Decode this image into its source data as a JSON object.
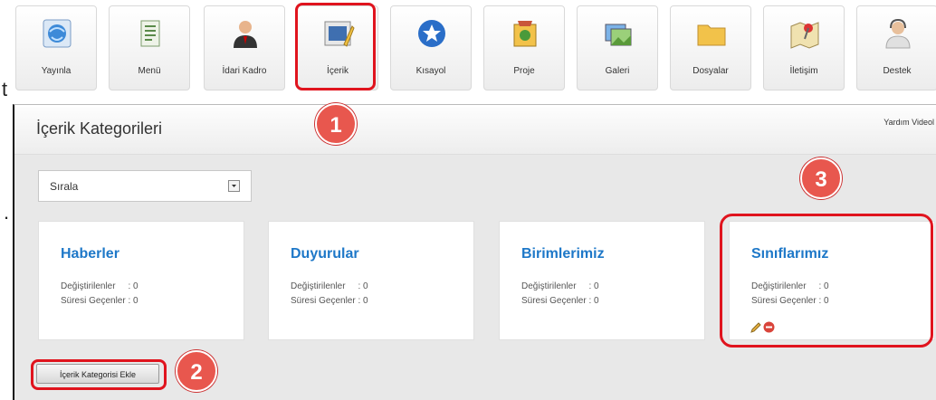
{
  "toolbar": {
    "items": [
      {
        "label": "Yayınla",
        "icon": "globe-icon"
      },
      {
        "label": "Menü",
        "icon": "menu-list-icon"
      },
      {
        "label": "İdari Kadro",
        "icon": "person-icon"
      },
      {
        "label": "İçerik",
        "icon": "content-icon"
      },
      {
        "label": "Kısayol",
        "icon": "star-icon"
      },
      {
        "label": "Proje",
        "icon": "project-icon"
      },
      {
        "label": "Galeri",
        "icon": "gallery-icon"
      },
      {
        "label": "Dosyalar",
        "icon": "folder-icon"
      },
      {
        "label": "İletişim",
        "icon": "map-pin-icon"
      },
      {
        "label": "Destek",
        "icon": "support-icon"
      }
    ]
  },
  "left_fragments": {
    "top": "t",
    "bottom": "."
  },
  "page": {
    "title": "İçerik Kategorileri",
    "help": "Yardım Videol"
  },
  "sort": {
    "value": "Sırala"
  },
  "cards": [
    {
      "title": "Haberler",
      "changed": "Değiştirilenler     : 0",
      "expired": "Süresi Geçenler : 0"
    },
    {
      "title": "Duyurular",
      "changed": "Değiştirilenler     : 0",
      "expired": "Süresi Geçenler : 0"
    },
    {
      "title": "Birimlerimiz",
      "changed": "Değiştirilenler     : 0",
      "expired": "Süresi Geçenler : 0"
    },
    {
      "title": "Sınıflarımız",
      "changed": "Değiştirilenler     : 0",
      "expired": "Süresi Geçenler : 0"
    }
  ],
  "add_button": "İçerik Kategorisi Ekle",
  "callouts": [
    "1",
    "2",
    "3"
  ],
  "colors": {
    "highlight": "#e0141e",
    "callout": "#e8574e",
    "card_title": "#1e78c8"
  }
}
